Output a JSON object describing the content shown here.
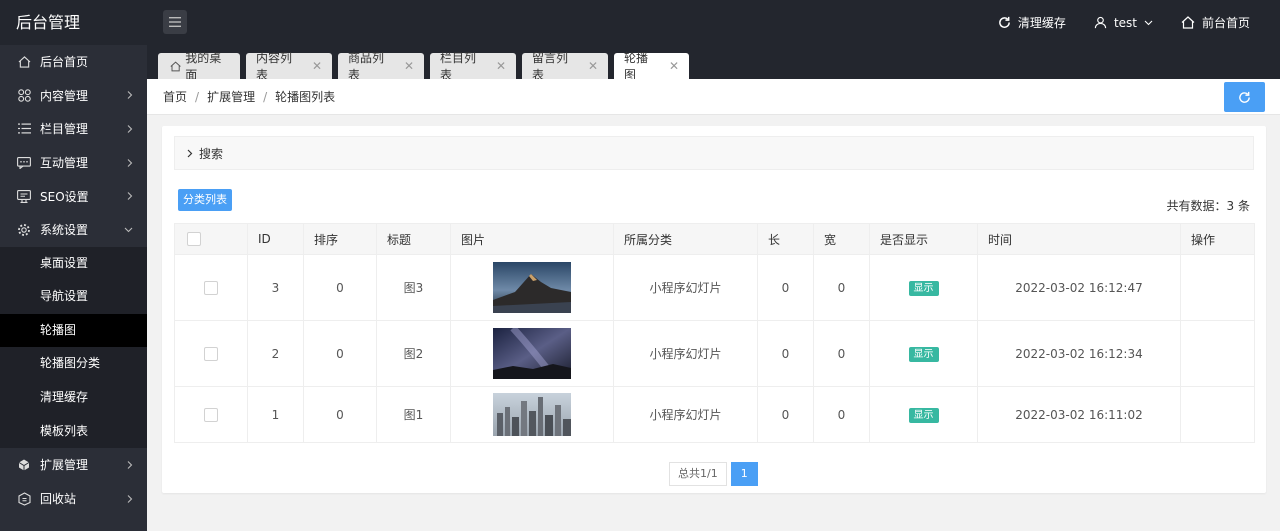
{
  "app": {
    "title": "后台管理"
  },
  "topbar": {
    "clear_cache": "清理缓存",
    "user": "test",
    "front_home": "前台首页"
  },
  "sidebar": {
    "items": [
      {
        "label": "后台首页",
        "icon": "home-icon"
      },
      {
        "label": "内容管理",
        "icon": "grid-icon"
      },
      {
        "label": "栏目管理",
        "icon": "list-icon"
      },
      {
        "label": "互动管理",
        "icon": "chat-icon"
      },
      {
        "label": "SEO设置",
        "icon": "seo-icon"
      },
      {
        "label": "系统设置",
        "icon": "gear-icon"
      }
    ],
    "sub_items": [
      "桌面设置",
      "导航设置",
      "轮播图",
      "轮播图分类",
      "清理缓存",
      "模板列表"
    ],
    "bottom_items": [
      {
        "label": "扩展管理",
        "icon": "extension-icon"
      },
      {
        "label": "回收站",
        "icon": "trash-icon"
      }
    ]
  },
  "tabs": [
    {
      "label": "我的桌面"
    },
    {
      "label": "内容列表"
    },
    {
      "label": "商品列表"
    },
    {
      "label": "栏目列表"
    },
    {
      "label": "留言列表"
    },
    {
      "label": "轮播图"
    }
  ],
  "breadcrumb": [
    "首页",
    "扩展管理",
    "轮播图列表"
  ],
  "search": {
    "label": "搜索"
  },
  "category_button": "分类列表",
  "count_text": "共有数据：3 条",
  "table": {
    "headers": [
      "ID",
      "排序",
      "标题",
      "图片",
      "所属分类",
      "长",
      "宽",
      "是否显示",
      "时间",
      "操作"
    ],
    "rows": [
      {
        "id": "3",
        "sort": "0",
        "title": "图3",
        "category": "小程序幻灯片",
        "length": "0",
        "width": "0",
        "show": "显示",
        "time": "2022-03-02 16:12:47"
      },
      {
        "id": "2",
        "sort": "0",
        "title": "图2",
        "category": "小程序幻灯片",
        "length": "0",
        "width": "0",
        "show": "显示",
        "time": "2022-03-02 16:12:34"
      },
      {
        "id": "1",
        "sort": "0",
        "title": "图1",
        "category": "小程序幻灯片",
        "length": "0",
        "width": "0",
        "show": "显示",
        "time": "2022-03-02 16:11:02"
      }
    ]
  },
  "pagination": {
    "total": "总共1/1",
    "current": "1"
  },
  "colors": {
    "accent": "#4a9ff5",
    "badge": "#37b8a1",
    "topbar": "#23262e",
    "sidebar": "#2b2e37"
  }
}
